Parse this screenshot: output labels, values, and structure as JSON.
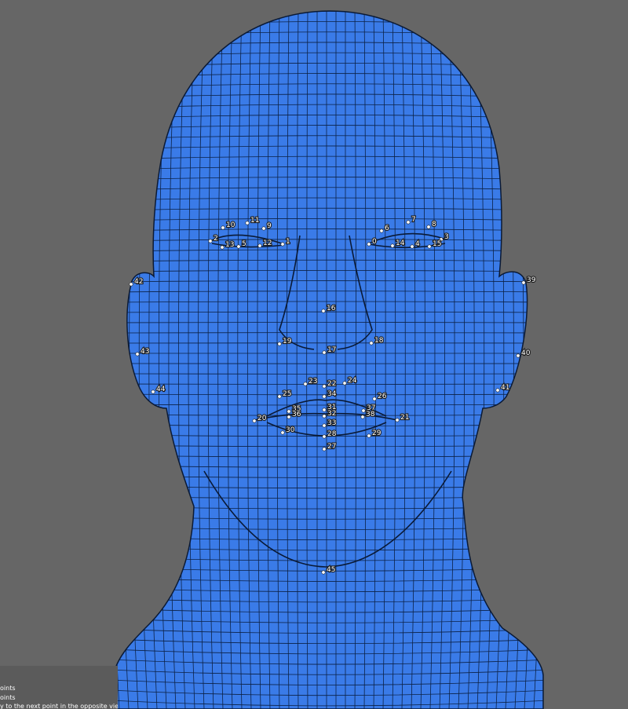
{
  "viewport": {
    "background": "#666666",
    "mesh_color": "#3a7be8",
    "wire_color": "#0c2247"
  },
  "landmarks": [
    {
      "id": "0"
    },
    {
      "id": "1"
    },
    {
      "id": "2"
    },
    {
      "id": "3"
    },
    {
      "id": "4"
    },
    {
      "id": "5"
    },
    {
      "id": "6"
    },
    {
      "id": "7"
    },
    {
      "id": "8"
    },
    {
      "id": "9"
    },
    {
      "id": "10"
    },
    {
      "id": "11"
    },
    {
      "id": "12"
    },
    {
      "id": "13"
    },
    {
      "id": "14"
    },
    {
      "id": "15"
    },
    {
      "id": "16"
    },
    {
      "id": "17"
    },
    {
      "id": "18"
    },
    {
      "id": "19"
    },
    {
      "id": "20"
    },
    {
      "id": "21"
    },
    {
      "id": "22"
    },
    {
      "id": "23"
    },
    {
      "id": "24"
    },
    {
      "id": "25"
    },
    {
      "id": "26"
    },
    {
      "id": "27"
    },
    {
      "id": "28"
    },
    {
      "id": "29"
    },
    {
      "id": "30"
    },
    {
      "id": "31"
    },
    {
      "id": "32"
    },
    {
      "id": "33"
    },
    {
      "id": "34"
    },
    {
      "id": "35"
    },
    {
      "id": "36"
    },
    {
      "id": "37"
    },
    {
      "id": "38"
    },
    {
      "id": "39"
    },
    {
      "id": "40"
    },
    {
      "id": "41"
    },
    {
      "id": "42"
    },
    {
      "id": "43"
    },
    {
      "id": "44"
    },
    {
      "id": "45"
    }
  ],
  "hints": {
    "line1": "oints",
    "line2": "oints",
    "line3": "y to the next point in the opposite viewport"
  }
}
